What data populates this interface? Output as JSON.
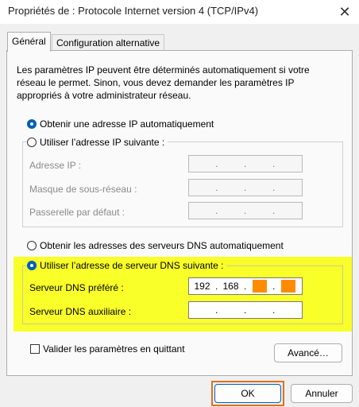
{
  "window": {
    "title": "Propriétés de : Protocole Internet version 4 (TCP/IPv4)",
    "close_glyph": "✕"
  },
  "tabs": [
    {
      "label": "Général",
      "active": true
    },
    {
      "label": "Configuration alternative",
      "active": false
    }
  ],
  "description": "Les paramètres IP peuvent être déterminés automatiquement si votre réseau le permet. Sinon, vous devez demander les paramètres IP appropriés à votre administrateur réseau.",
  "ip": {
    "auto_label": "Obtenir une adresse IP automatiquement",
    "manual_label": "Utiliser l’adresse IP suivante :",
    "selected": "auto",
    "fields": [
      {
        "label": "Adresse IP :"
      },
      {
        "label": "Masque de sous-réseau :"
      },
      {
        "label": "Passerelle par défaut :"
      }
    ]
  },
  "dns": {
    "auto_label": "Obtenir les adresses des serveurs DNS automatiquement",
    "manual_label": "Utiliser l’adresse de serveur DNS suivante :",
    "selected": "manual",
    "preferred": {
      "label": "Serveur DNS préféré :",
      "oct1": "192",
      "oct2": "168",
      "oct3": "",
      "oct4": ""
    },
    "alternate": {
      "label": "Serveur DNS auxiliaire :"
    }
  },
  "validate_label": "Valider les paramètres en quittant",
  "advanced_label": "Avancé…",
  "ok_label": "OK",
  "cancel_label": "Annuler",
  "colors": {
    "highlight": "#f9ff28",
    "redaction": "#ff8c00",
    "accent": "#005fb8",
    "ok_outline": "#e07020"
  }
}
